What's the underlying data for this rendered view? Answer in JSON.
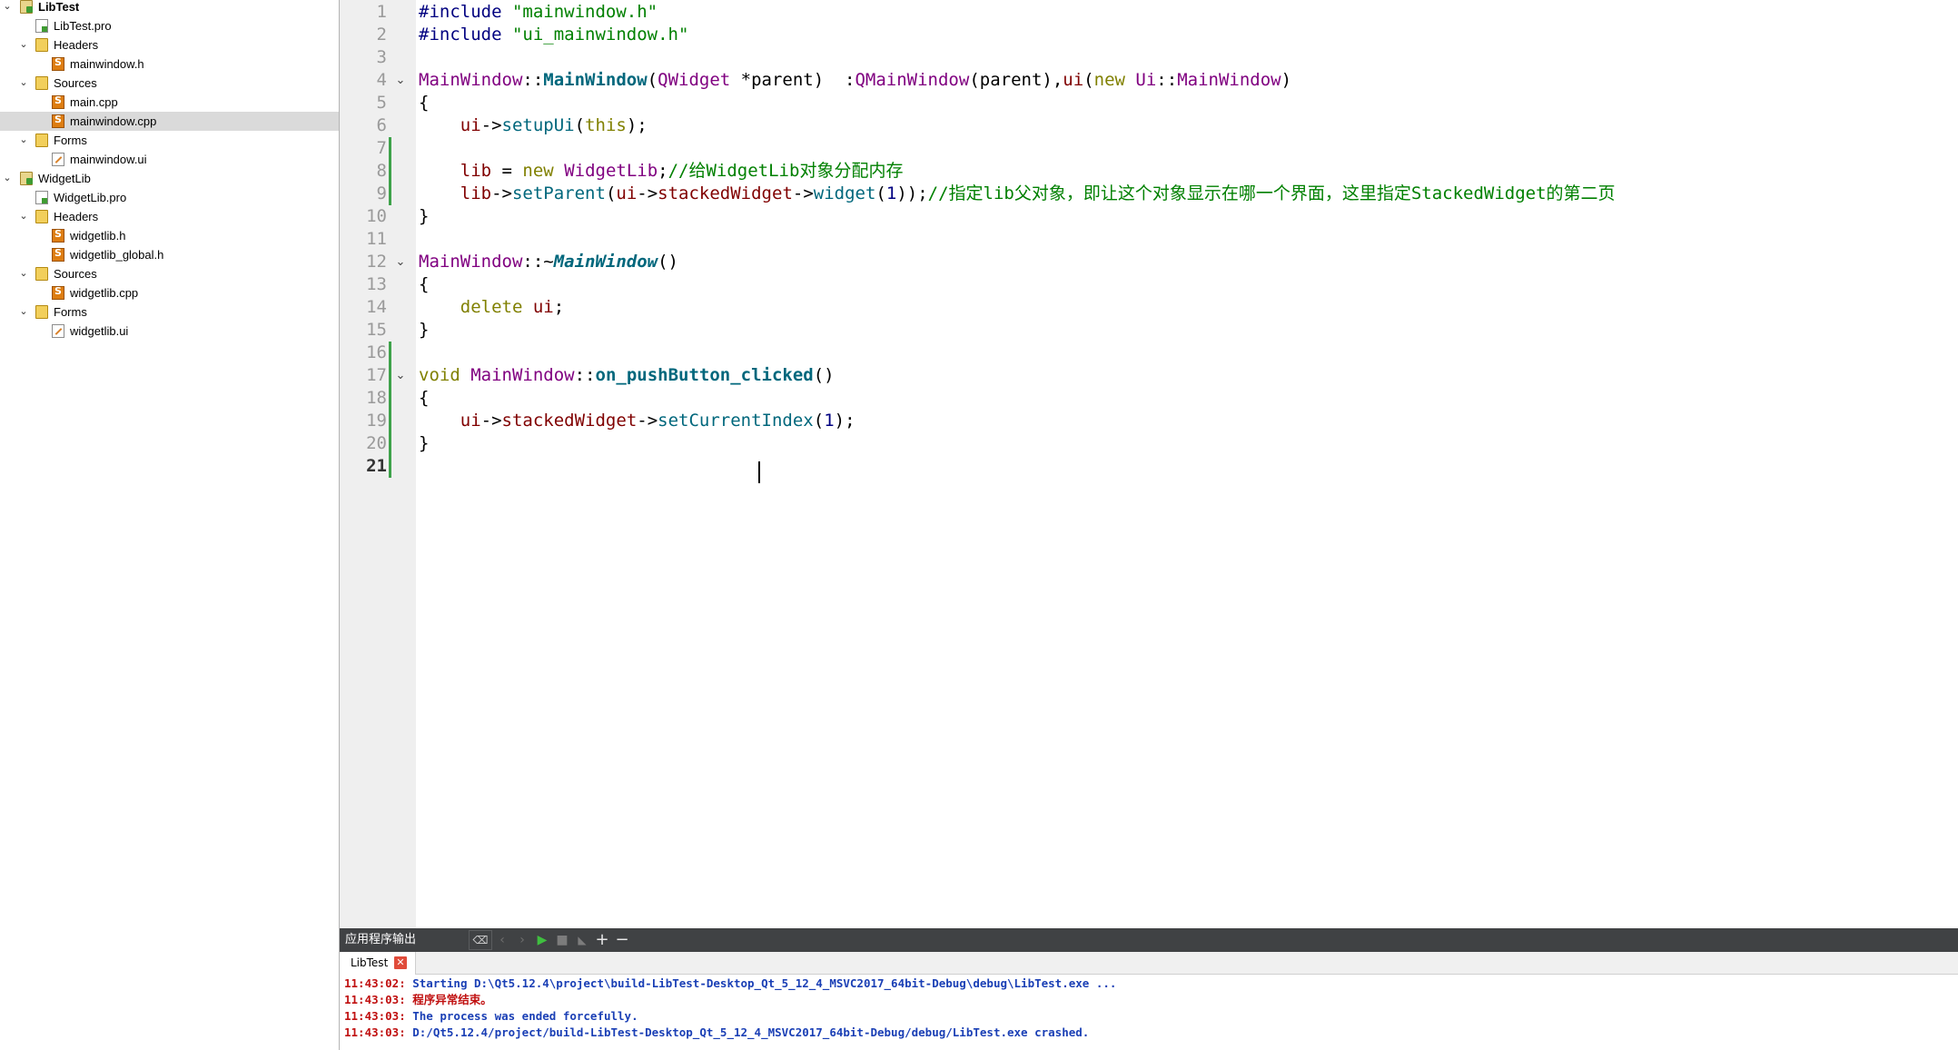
{
  "project_tree": {
    "items": [
      {
        "label": "LibTest",
        "icon": "project-icon",
        "expanded": true,
        "bold": true
      },
      {
        "label": "LibTest.pro",
        "icon": "pro-file-icon"
      },
      {
        "label": "Headers",
        "icon": "headers-folder-icon",
        "expanded": true
      },
      {
        "label": "mainwindow.h",
        "icon": "header-file-icon"
      },
      {
        "label": "Sources",
        "icon": "sources-folder-icon",
        "expanded": true
      },
      {
        "label": "main.cpp",
        "icon": "source-file-icon"
      },
      {
        "label": "mainwindow.cpp",
        "icon": "source-file-icon",
        "selected": true
      },
      {
        "label": "Forms",
        "icon": "forms-folder-icon",
        "expanded": true
      },
      {
        "label": "mainwindow.ui",
        "icon": "ui-file-icon"
      },
      {
        "label": "WidgetLib",
        "icon": "project-icon",
        "expanded": true
      },
      {
        "label": "WidgetLib.pro",
        "icon": "pro-file-icon"
      },
      {
        "label": "Headers",
        "icon": "headers-folder-icon",
        "expanded": true
      },
      {
        "label": "widgetlib.h",
        "icon": "header-file-icon"
      },
      {
        "label": "widgetlib_global.h",
        "icon": "header-file-icon"
      },
      {
        "label": "Sources",
        "icon": "sources-folder-icon",
        "expanded": true
      },
      {
        "label": "widgetlib.cpp",
        "icon": "source-file-icon"
      },
      {
        "label": "Forms",
        "icon": "forms-folder-icon",
        "expanded": true
      },
      {
        "label": "widgetlib.ui",
        "icon": "ui-file-icon"
      }
    ]
  },
  "editor": {
    "current_line": 21,
    "lines": [
      [
        [
          "pp",
          "#include "
        ],
        [
          "str",
          "\"mainwindow.h\""
        ]
      ],
      [
        [
          "pp",
          "#include "
        ],
        [
          "str",
          "\"ui_mainwindow.h\""
        ]
      ],
      [],
      [
        [
          "typ",
          "MainWindow"
        ],
        [
          "",
          "::"
        ],
        [
          "fndef",
          "MainWindow"
        ],
        [
          "",
          "("
        ],
        [
          "typ",
          "QWidget"
        ],
        [
          "",
          " *parent)  :"
        ],
        [
          "typ",
          "QMainWindow"
        ],
        [
          "",
          "(parent),"
        ],
        [
          "mem",
          "ui"
        ],
        [
          "",
          "("
        ],
        [
          "kw",
          "new"
        ],
        [
          "",
          " "
        ],
        [
          "typ",
          "Ui"
        ],
        [
          "",
          "::"
        ],
        [
          "typ",
          "MainWindow"
        ],
        [
          "",
          ")"
        ]
      ],
      [
        [
          "",
          "{"
        ]
      ],
      [
        [
          "",
          "    "
        ],
        [
          "mem",
          "ui"
        ],
        [
          "",
          "->"
        ],
        [
          "fn",
          "setupUi"
        ],
        [
          "",
          "("
        ],
        [
          "kw",
          "this"
        ],
        [
          "",
          ");"
        ]
      ],
      [],
      [
        [
          "",
          "    "
        ],
        [
          "mem",
          "lib"
        ],
        [
          "",
          " = "
        ],
        [
          "kw",
          "new"
        ],
        [
          "",
          " "
        ],
        [
          "typ",
          "WidgetLib"
        ],
        [
          "",
          ";"
        ],
        [
          "cmt",
          "//给WidgetLib对象分配内存"
        ]
      ],
      [
        [
          "",
          "    "
        ],
        [
          "mem",
          "lib"
        ],
        [
          "",
          "->"
        ],
        [
          "fn",
          "setParent"
        ],
        [
          "",
          "("
        ],
        [
          "mem",
          "ui"
        ],
        [
          "",
          "->"
        ],
        [
          "mem",
          "stackedWidget"
        ],
        [
          "",
          "->"
        ],
        [
          "fn",
          "widget"
        ],
        [
          "",
          "("
        ],
        [
          "num",
          "1"
        ],
        [
          "",
          "));"
        ],
        [
          "cmt",
          "//指定lib父对象，即让这个对象显示在哪一个界面，这里指定StackedWidget的第二页"
        ]
      ],
      [
        [
          "",
          "}"
        ]
      ],
      [],
      [
        [
          "typ",
          "MainWindow"
        ],
        [
          "",
          "::~"
        ],
        [
          "fnit",
          "MainWindow"
        ],
        [
          "",
          "()"
        ]
      ],
      [
        [
          "",
          "{"
        ]
      ],
      [
        [
          "",
          "    "
        ],
        [
          "kw",
          "delete"
        ],
        [
          "",
          " "
        ],
        [
          "mem",
          "ui"
        ],
        [
          "",
          ";"
        ]
      ],
      [
        [
          "",
          "}"
        ]
      ],
      [],
      [
        [
          "kw",
          "void"
        ],
        [
          "",
          " "
        ],
        [
          "typ",
          "MainWindow"
        ],
        [
          "",
          "::"
        ],
        [
          "fndef",
          "on_pushButton_clicked"
        ],
        [
          "",
          "()"
        ]
      ],
      [
        [
          "",
          "{"
        ]
      ],
      [
        [
          "",
          "    "
        ],
        [
          "mem",
          "ui"
        ],
        [
          "",
          "->"
        ],
        [
          "mem",
          "stackedWidget"
        ],
        [
          "",
          "->"
        ],
        [
          "fn",
          "setCurrentIndex"
        ],
        [
          "",
          "("
        ],
        [
          "num",
          "1"
        ],
        [
          "",
          ");"
        ]
      ],
      [
        [
          "",
          "}"
        ]
      ],
      []
    ],
    "fold_markers": [
      4,
      12,
      17
    ]
  },
  "output_pane": {
    "title": "应用程序输出",
    "tab_label": "LibTest",
    "log": [
      {
        "time": "11:43:02:",
        "text": " Starting D:\\Qt5.12.4\\project\\build-LibTest-Desktop_Qt_5_12_4_MSVC2017_64bit-Debug\\debug\\LibTest.exe ...",
        "color": "blue"
      },
      {
        "time": "11:43:03:",
        "text": " 程序异常结束。",
        "color": "red"
      },
      {
        "time": "11:43:03:",
        "text": " The process was ended forcefully.",
        "color": "blue"
      },
      {
        "time": "11:43:03:",
        "text": " D:/Qt5.12.4/project/build-LibTest-Desktop_Qt_5_12_4_MSVC2017_64bit-Debug/debug/LibTest.exe crashed.",
        "color": "blue"
      }
    ]
  },
  "colors": {
    "log_blue": "#1a3fb5",
    "log_red": "#c01010",
    "change_bar": "#3ea24a",
    "gutter": "#efefef",
    "toolbar": "#404244"
  }
}
